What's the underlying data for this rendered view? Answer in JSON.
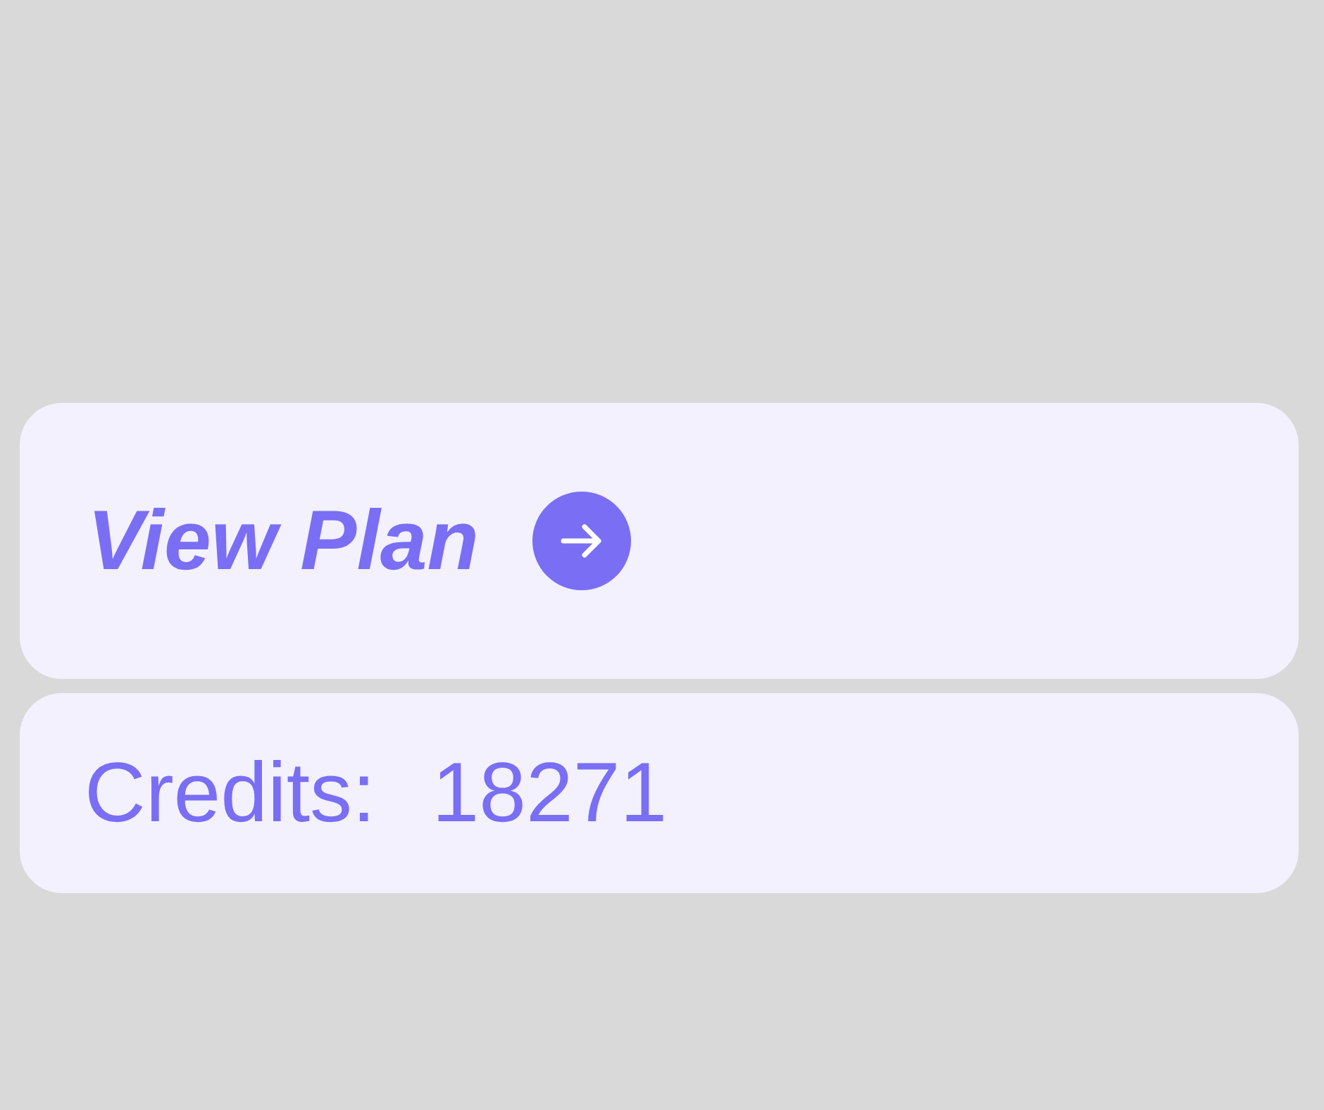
{
  "plan_card": {
    "label": "View Plan"
  },
  "credits_card": {
    "label": "Credits:",
    "value": "18271"
  }
}
